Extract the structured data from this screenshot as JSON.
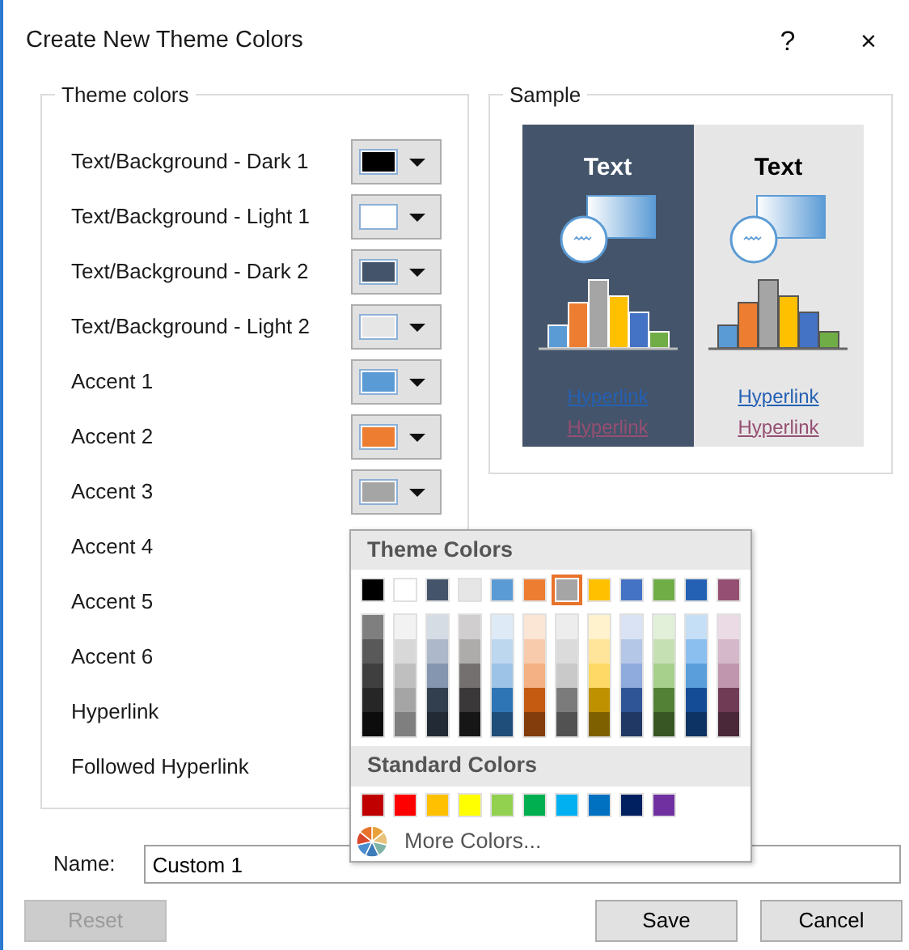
{
  "window": {
    "title": "Create New Theme Colors",
    "help_button": "?",
    "close_button": "×"
  },
  "theme_colors": {
    "legend": "Theme colors",
    "items": [
      {
        "label": "Text/Background - Dark 1",
        "color": "#000000"
      },
      {
        "label": "Text/Background - Light 1",
        "color": "#ffffff"
      },
      {
        "label": "Text/Background - Dark 2",
        "color": "#44546a"
      },
      {
        "label": "Text/Background - Light 2",
        "color": "#e7e6e6"
      },
      {
        "label": "Accent 1",
        "color": "#5b9bd5"
      },
      {
        "label": "Accent 2",
        "color": "#ed7d31"
      },
      {
        "label": "Accent 3",
        "color": "#a5a5a5"
      },
      {
        "label": "Accent 4"
      },
      {
        "label": "Accent 5"
      },
      {
        "label": "Accent 6"
      },
      {
        "label": "Hyperlink"
      },
      {
        "label": "Followed Hyperlink"
      }
    ]
  },
  "sample": {
    "legend": "Sample",
    "panels": [
      {
        "kind": "dark",
        "heading": "Text",
        "link": "Hyperlink",
        "followed_link": "Hyperlink"
      },
      {
        "kind": "light",
        "heading": "Text",
        "link": "Hyperlink",
        "followed_link": "Hyperlink"
      }
    ]
  },
  "color_menu": {
    "theme_heading": "Theme Colors",
    "theme_colors": [
      {
        "color": "#000000",
        "selected": false,
        "shades": [
          {
            "color": "#7f7f7f"
          },
          {
            "color": "#595959"
          },
          {
            "color": "#3f3f3f"
          },
          {
            "color": "#262626"
          },
          {
            "color": "#0c0c0c"
          }
        ]
      },
      {
        "color": "#ffffff",
        "selected": false,
        "shades": [
          {
            "color": "#f2f2f2"
          },
          {
            "color": "#d8d8d8"
          },
          {
            "color": "#bfbfbf"
          },
          {
            "color": "#a5a5a5"
          },
          {
            "color": "#7f7f7f"
          }
        ]
      },
      {
        "color": "#44546a",
        "selected": false,
        "shades": [
          {
            "color": "#d6dce4"
          },
          {
            "color": "#adb9ca"
          },
          {
            "color": "#8496b0"
          },
          {
            "color": "#323f4f"
          },
          {
            "color": "#222a35"
          }
        ]
      },
      {
        "color": "#e7e6e6",
        "selected": false,
        "shades": [
          {
            "color": "#d0cece"
          },
          {
            "color": "#aeabab"
          },
          {
            "color": "#757070"
          },
          {
            "color": "#3a3838"
          },
          {
            "color": "#171616"
          }
        ]
      },
      {
        "color": "#5b9bd5",
        "selected": false,
        "shades": [
          {
            "color": "#deebf6"
          },
          {
            "color": "#bdd7ee"
          },
          {
            "color": "#9dc3e6"
          },
          {
            "color": "#2e75b5"
          },
          {
            "color": "#1e4e79"
          }
        ]
      },
      {
        "color": "#ed7d31",
        "selected": false,
        "shades": [
          {
            "color": "#fbe5d5"
          },
          {
            "color": "#f7cbac"
          },
          {
            "color": "#f4b183"
          },
          {
            "color": "#c55a11"
          },
          {
            "color": "#833c0b"
          }
        ]
      },
      {
        "color": "#a5a5a5",
        "selected": true,
        "shades": [
          {
            "color": "#ededed"
          },
          {
            "color": "#dbdbdb"
          },
          {
            "color": "#c9c9c9"
          },
          {
            "color": "#7b7b7b"
          },
          {
            "color": "#525252"
          }
        ]
      },
      {
        "color": "#ffc000",
        "selected": false,
        "shades": [
          {
            "color": "#fff2cc"
          },
          {
            "color": "#fee599"
          },
          {
            "color": "#ffd965"
          },
          {
            "color": "#bf9000"
          },
          {
            "color": "#7f6000"
          }
        ]
      },
      {
        "color": "#4472c4",
        "selected": false,
        "shades": [
          {
            "color": "#dae3f3"
          },
          {
            "color": "#b4c7e7"
          },
          {
            "color": "#8faadc"
          },
          {
            "color": "#2f5597"
          },
          {
            "color": "#1f3864"
          }
        ]
      },
      {
        "color": "#70ad47",
        "selected": false,
        "shades": [
          {
            "color": "#e2efd9"
          },
          {
            "color": "#c5e0b3"
          },
          {
            "color": "#a8d08d"
          },
          {
            "color": "#538135"
          },
          {
            "color": "#375623"
          }
        ]
      },
      {
        "color": "#2461b5",
        "selected": false,
        "shades": [
          {
            "color": "#c5dff6"
          },
          {
            "color": "#8bbff0"
          },
          {
            "color": "#5a9fdc"
          },
          {
            "color": "#144d96"
          },
          {
            "color": "#0d3264"
          }
        ]
      },
      {
        "color": "#954f72",
        "selected": false,
        "shades": [
          {
            "color": "#eadbe4"
          },
          {
            "color": "#d5b8c9"
          },
          {
            "color": "#c095ae"
          },
          {
            "color": "#6f3b55"
          },
          {
            "color": "#4a2739"
          }
        ]
      }
    ],
    "standard_heading": "Standard Colors",
    "standard_colors": [
      {
        "color": "#c00000"
      },
      {
        "color": "#ff0000"
      },
      {
        "color": "#ffc000"
      },
      {
        "color": "#ffff00"
      },
      {
        "color": "#92d050"
      },
      {
        "color": "#00b050"
      },
      {
        "color": "#00b0f0"
      },
      {
        "color": "#0070c0"
      },
      {
        "color": "#002060"
      },
      {
        "color": "#7030a0"
      }
    ],
    "more_colors": "More Colors..."
  },
  "name_field": {
    "label": "Name:",
    "value": "Custom 1"
  },
  "buttons": [
    {
      "label": "Reset",
      "disabled": true
    },
    {
      "label": "Save",
      "disabled": false
    },
    {
      "label": "Cancel",
      "disabled": false
    }
  ]
}
